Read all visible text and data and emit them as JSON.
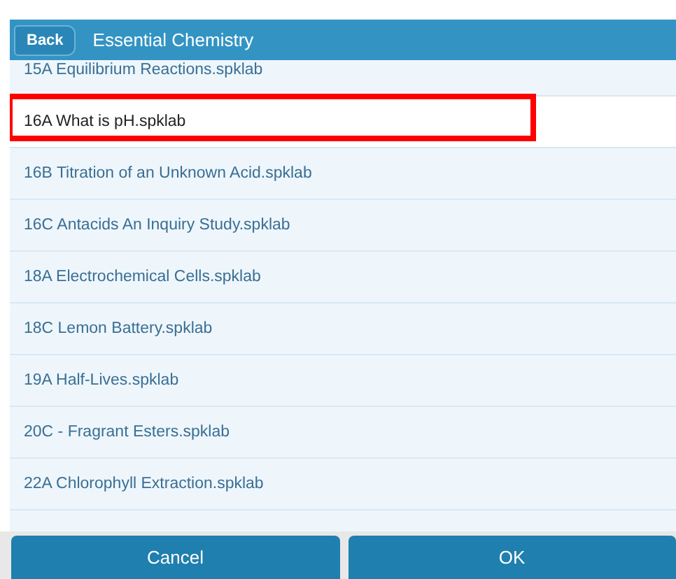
{
  "header": {
    "back_button": "Back",
    "title": "Essential Chemistry"
  },
  "files": [
    {
      "name": "15A Equilibrium Reactions.spklab",
      "selected": false,
      "highlighted": false
    },
    {
      "name": "16A What is pH.spklab",
      "selected": true,
      "highlighted": true
    },
    {
      "name": "16B Titration of an Unknown Acid.spklab",
      "selected": false,
      "highlighted": false
    },
    {
      "name": "16C Antacids An Inquiry Study.spklab",
      "selected": false,
      "highlighted": false
    },
    {
      "name": "18A Electrochemical Cells.spklab",
      "selected": false,
      "highlighted": false
    },
    {
      "name": "18C Lemon Battery.spklab",
      "selected": false,
      "highlighted": false
    },
    {
      "name": "19A Half-Lives.spklab",
      "selected": false,
      "highlighted": false
    },
    {
      "name": "20C - Fragrant Esters.spklab",
      "selected": false,
      "highlighted": false
    },
    {
      "name": "22A Chlorophyll Extraction.spklab",
      "selected": false,
      "highlighted": false
    }
  ],
  "buttons": [
    "Cancel",
    "OK"
  ]
}
